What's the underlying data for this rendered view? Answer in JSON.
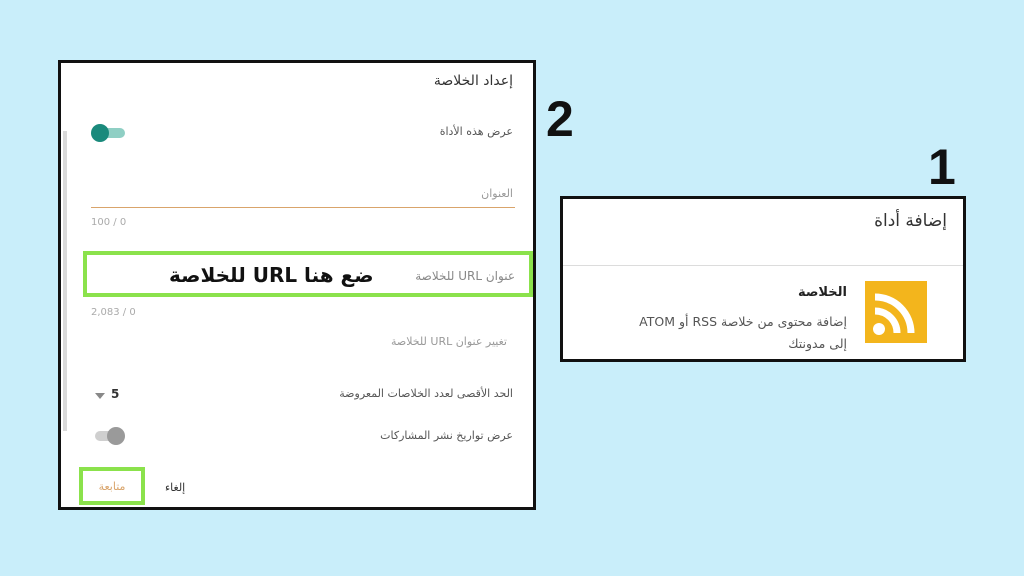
{
  "step_labels": {
    "one": "1",
    "two": "2"
  },
  "feed_setup": {
    "title": "إعداد الخلاصة",
    "show_widget_label": "عرض هذه الأداة",
    "show_widget_on": true,
    "title_placeholder": "العنوان",
    "title_counter": "100 / 0",
    "url_label": "عنوان URL للخلاصة",
    "url_annotation": "ضع هنا URL للخلاصة",
    "url_counter": "2,083 / 0",
    "change_url_label": "تغيير عنوان URL للخلاصة",
    "max_items_label": "الحد الأقصى لعدد الخلاصات المعروضة",
    "max_items_value": "5",
    "show_dates_label": "عرض تواريخ نشر المشاركات",
    "show_dates_on": false,
    "continue_label": "متابعة",
    "cancel_label": "إلغاء"
  },
  "add_widget": {
    "title": "إضافة أداة",
    "widget_name": "الخلاصة",
    "widget_desc_line1": "إضافة محتوى من خلاصة RSS أو ATOM",
    "widget_desc_line2": "إلى مدونتك",
    "icon": "rss-icon"
  },
  "colors": {
    "background": "#c9eefa",
    "highlight": "#8be24c",
    "toggle_on": "#1a8a7c",
    "rss_tile": "#f3b51c",
    "title_underline": "#d9a46b"
  }
}
